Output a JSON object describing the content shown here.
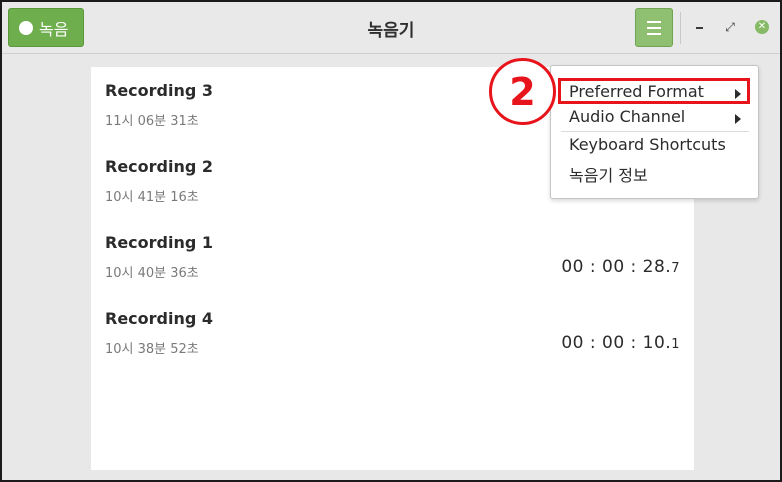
{
  "header": {
    "record_label": "녹음",
    "title": "녹음기"
  },
  "recordings": [
    {
      "title": "Recording 3",
      "time": "11시 06분 31초",
      "duration_main": "",
      "duration_frac": ""
    },
    {
      "title": "Recording 2",
      "time": "10시 41분 16초",
      "duration_main": "",
      "duration_frac": ""
    },
    {
      "title": "Recording 1",
      "time": "10시 40분 36초",
      "duration_main": "00 : 00 : 28.",
      "duration_frac": "7"
    },
    {
      "title": "Recording 4",
      "time": "10시 38분 52초",
      "duration_main": "00 : 00 : 10.",
      "duration_frac": "1"
    }
  ],
  "menu": {
    "items": [
      {
        "label": "Preferred Format",
        "submenu": true
      },
      {
        "label": "Audio Channel",
        "submenu": true
      },
      {
        "label": "Keyboard Shortcuts",
        "submenu": false
      },
      {
        "label": "녹음기 정보",
        "submenu": false
      }
    ]
  },
  "callout": {
    "number": "2"
  },
  "colors": {
    "accent_green": "#6eae4c",
    "highlight_red": "#e8141b"
  }
}
